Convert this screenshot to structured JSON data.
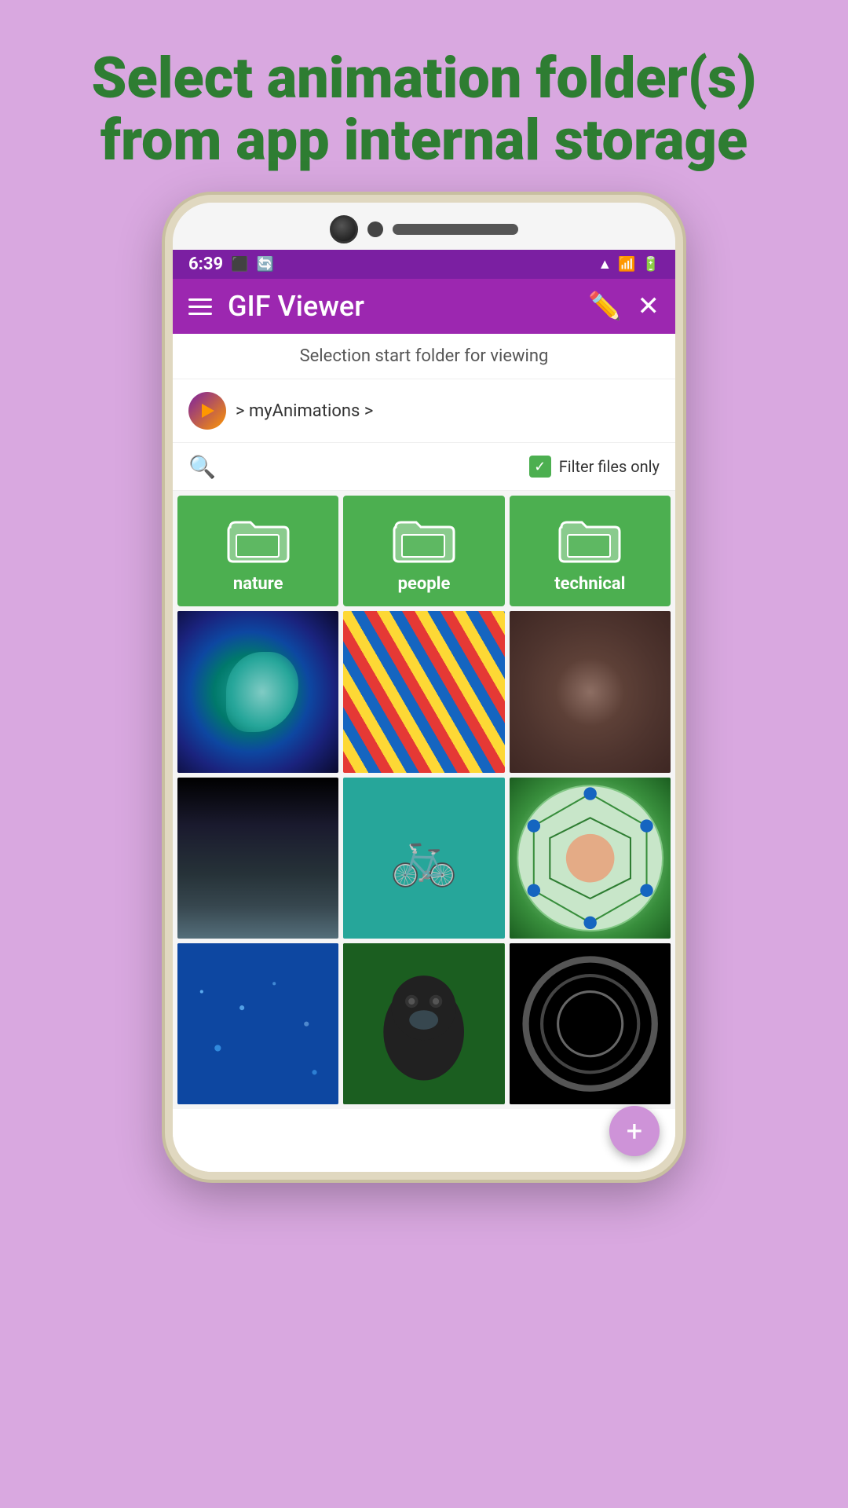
{
  "page": {
    "background_color": "#d9a8e0",
    "heading_line1": "Select animation folder(s)",
    "heading_line2": "from app internal storage",
    "heading_color": "#2e7d32"
  },
  "status_bar": {
    "time": "6:39",
    "color": "#7b1fa2"
  },
  "toolbar": {
    "title": "GIF Viewer",
    "background": "#9c27b0"
  },
  "subtitle": "Selection start folder for viewing",
  "breadcrumb": {
    "text": "> myAnimations >"
  },
  "filter": {
    "label": "Filter files only",
    "checked": true
  },
  "folders": [
    {
      "name": "nature"
    },
    {
      "name": "people"
    },
    {
      "name": "technical"
    }
  ],
  "search": {
    "placeholder": "Search"
  },
  "fab": {
    "label": "+"
  }
}
